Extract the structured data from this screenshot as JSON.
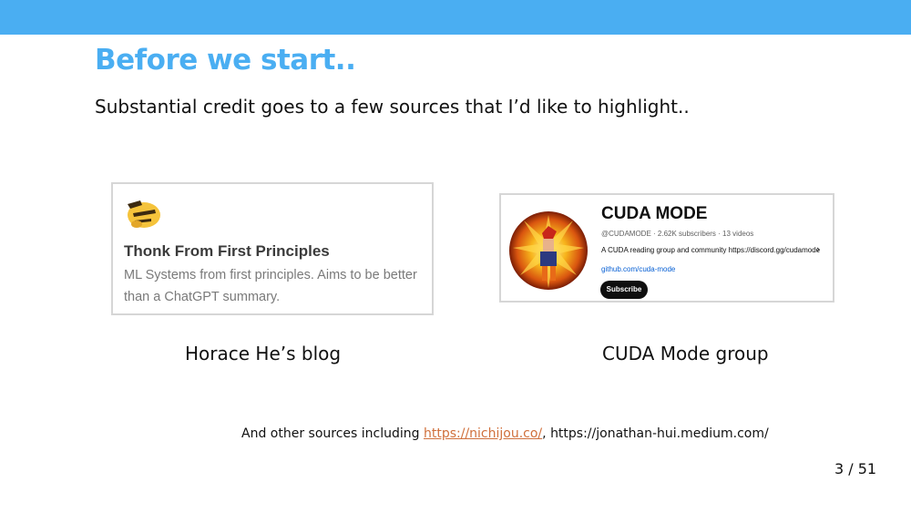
{
  "slide": {
    "title": "Before we start..",
    "subtitle": "Substantial credit goes to a few sources that I’d like to highlight..",
    "page_number": "3 / 51",
    "accent_color": "#4aaef2"
  },
  "blog_card": {
    "icon": "thinking-face-icon",
    "name": "Thonk From First Principles",
    "description": "ML Systems from first principles. Aims to be better than a ChatGPT summary.",
    "caption": "Horace He’s blog"
  },
  "cuda_card": {
    "avatar": "channel-avatar",
    "name": "CUDA MODE",
    "meta": "@CUDAMODE · 2.62K subscribers · 13 videos",
    "description": "A CUDA reading group and community https://discord.gg/cudamode",
    "link": "github.com/cuda-mode",
    "subscribe_label": "Subscribe",
    "caption": "CUDA Mode group"
  },
  "sources": {
    "prefix": "And other sources including ",
    "link1": "https://nichijou.co/",
    "separator": ", ",
    "link2": "https://jonathan-hui.medium.com/",
    "link_color": "#d0703c"
  }
}
